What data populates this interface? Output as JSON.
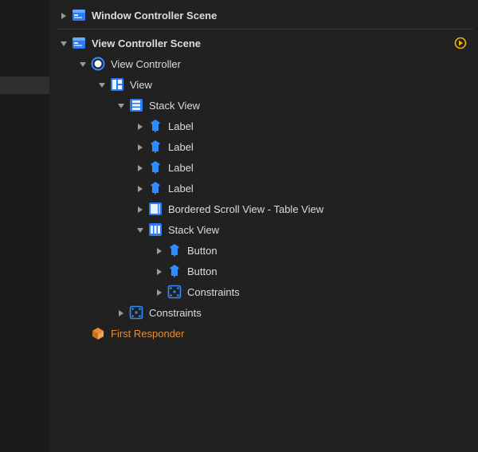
{
  "colors": {
    "blue": "#2b7bf6",
    "blueFill": "#2f8cff",
    "orange": "#e78b35",
    "yellow": "#f0b400",
    "text": "#dcdcdc"
  },
  "tree": {
    "scene0": {
      "label": "Window Controller Scene"
    },
    "scene1": {
      "label": "View Controller Scene"
    },
    "r0": {
      "label": "View Controller"
    },
    "r1": {
      "label": "View"
    },
    "r2": {
      "label": "Stack View"
    },
    "r3": {
      "label": "Label"
    },
    "r4": {
      "label": "Label"
    },
    "r5": {
      "label": "Label"
    },
    "r6": {
      "label": "Label"
    },
    "r7": {
      "label": "Bordered Scroll View - Table View"
    },
    "r8": {
      "label": "Stack View"
    },
    "r9": {
      "label": "Button"
    },
    "r10": {
      "label": "Button"
    },
    "r11": {
      "label": "Constraints"
    },
    "r12": {
      "label": "Constraints"
    },
    "r13": {
      "label": "First Responder"
    }
  }
}
